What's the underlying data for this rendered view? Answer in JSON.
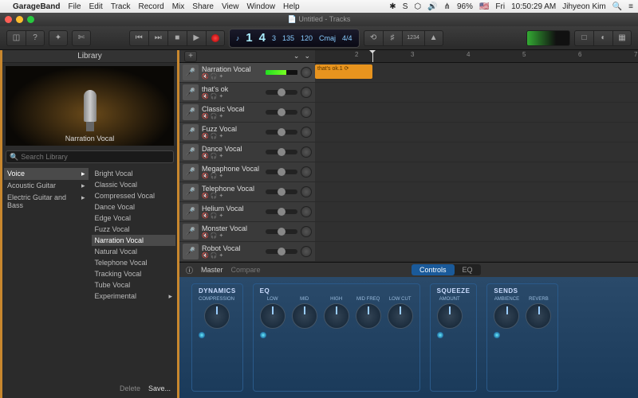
{
  "menubar": {
    "app": "GarageBand",
    "items": [
      "File",
      "Edit",
      "Track",
      "Record",
      "Mix",
      "Share",
      "View",
      "Window",
      "Help"
    ],
    "right": {
      "wifi": "96%",
      "day": "Fri",
      "time": "10:50:29 AM",
      "user": "Jihyeon Kim"
    }
  },
  "window": {
    "title": "Untitled - Tracks"
  },
  "lcd": {
    "bar": "1",
    "beat": "4",
    "sub": "3",
    "tempo": "135",
    "tempo2": "120",
    "key": "Cmaj",
    "sig": "4/4",
    "display": "1234"
  },
  "library": {
    "title": "Library",
    "preview_label": "Narration Vocal",
    "search_placeholder": "Search Library",
    "left": [
      "Voice",
      "Acoustic Guitar",
      "Electric Guitar and Bass"
    ],
    "right": [
      "Bright Vocal",
      "Classic Vocal",
      "Compressed Vocal",
      "Dance Vocal",
      "Edge Vocal",
      "Fuzz Vocal",
      "Narration Vocal",
      "Natural Vocal",
      "Telephone Vocal",
      "Tracking Vocal",
      "Tube Vocal",
      "Experimental"
    ],
    "left_sel": 0,
    "right_sel": 6,
    "delete": "Delete",
    "save": "Save..."
  },
  "tracks": [
    {
      "name": "Narration Vocal",
      "sel": true,
      "meter": true
    },
    {
      "name": "that's ok"
    },
    {
      "name": "Classic Vocal"
    },
    {
      "name": "Fuzz Vocal"
    },
    {
      "name": "Dance Vocal"
    },
    {
      "name": "Megaphone Vocal"
    },
    {
      "name": "Telephone Vocal"
    },
    {
      "name": "Helium Vocal"
    },
    {
      "name": "Monster Vocal"
    },
    {
      "name": "Robot Vocal"
    }
  ],
  "region": {
    "name": "that's ok.1"
  },
  "ruler": [
    "2",
    "3",
    "4",
    "5",
    "6",
    "7"
  ],
  "editor": {
    "info": "ⓘ",
    "master": "Master",
    "compare": "Compare",
    "tabs": [
      "Controls",
      "EQ"
    ],
    "active": 0,
    "groups": [
      {
        "title": "DYNAMICS",
        "knobs": [
          "COMPRESSION"
        ]
      },
      {
        "title": "EQ",
        "knobs": [
          "LOW",
          "MID",
          "HIGH",
          "MID FREQ",
          "LOW CUT"
        ]
      },
      {
        "title": "SQUEEZE",
        "knobs": [
          "AMOUNT"
        ]
      },
      {
        "title": "SENDS",
        "knobs": [
          "AMBIENCE",
          "REVERB"
        ]
      }
    ]
  }
}
